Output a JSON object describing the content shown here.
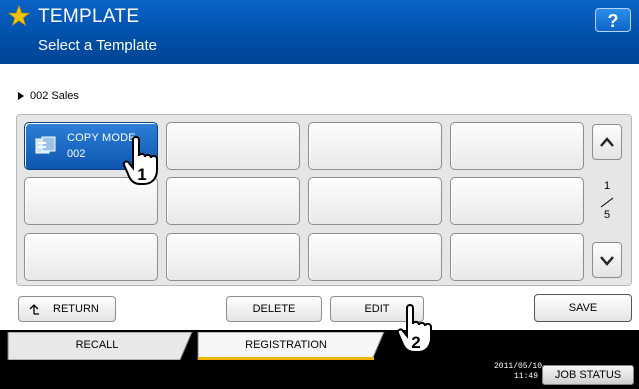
{
  "header": {
    "title": "TEMPLATE",
    "subtitle": "Select a Template",
    "help_label": "?",
    "icon": "star-icon"
  },
  "breadcrumb": {
    "label": "002 Sales"
  },
  "templates": [
    {
      "name": "COPY MODE",
      "number": "002",
      "selected": true
    },
    {
      "name": "",
      "number": ""
    },
    {
      "name": "",
      "number": ""
    },
    {
      "name": "",
      "number": ""
    },
    {
      "name": "",
      "number": ""
    },
    {
      "name": "",
      "number": ""
    },
    {
      "name": "",
      "number": ""
    },
    {
      "name": "",
      "number": ""
    },
    {
      "name": "",
      "number": ""
    },
    {
      "name": "",
      "number": ""
    },
    {
      "name": "",
      "number": ""
    },
    {
      "name": "",
      "number": ""
    }
  ],
  "pager": {
    "current": "1",
    "total": "5"
  },
  "buttons": {
    "return_label": "RETURN",
    "delete_label": "DELETE",
    "edit_label": "EDIT",
    "save_label": "SAVE"
  },
  "tabs": {
    "recall_label": "RECALL",
    "registration_label": "REGISTRATION",
    "active": "REGISTRATION"
  },
  "status": {
    "date": "2011/05/10",
    "time": "11:49",
    "job_status_label": "JOB STATUS"
  },
  "callouts": [
    "1",
    "2"
  ],
  "colors": {
    "header_blue": "#004fa8",
    "selected_blue": "#1565c0",
    "tab_accent": "#f0b400",
    "star": "#f5c400"
  }
}
